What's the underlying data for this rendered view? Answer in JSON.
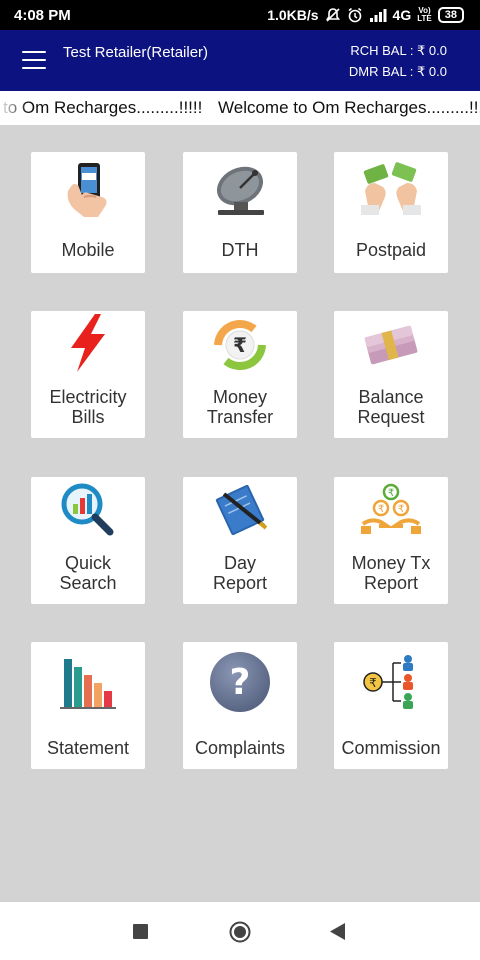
{
  "status_bar": {
    "time": "4:08 PM",
    "speed": "1.0KB/s",
    "network": "4G",
    "volte_top": "Vo)",
    "volte_bottom": "LTE",
    "battery": "38"
  },
  "app_bar": {
    "title": "Test Retailer(Retailer)",
    "rch_balance": "RCH BAL : ₹ 0.0",
    "dmr_balance": "DMR BAL : ₹ 0.0"
  },
  "marquee": {
    "text_1": "to Om Recharges.........!!!!!",
    "text_2": "Welcome to Om Recharges.........!!!!!"
  },
  "tiles": [
    {
      "label_1": "Mobile",
      "label_2": ""
    },
    {
      "label_1": "DTH",
      "label_2": ""
    },
    {
      "label_1": "Postpaid",
      "label_2": ""
    },
    {
      "label_1": "Electricity",
      "label_2": "Bills"
    },
    {
      "label_1": "Money",
      "label_2": "Transfer"
    },
    {
      "label_1": "Balance",
      "label_2": "Request"
    },
    {
      "label_1": "Quick",
      "label_2": "Search"
    },
    {
      "label_1": "Day",
      "label_2": "Report"
    },
    {
      "label_1": "Money Tx",
      "label_2": "Report"
    },
    {
      "label_1": "Statement",
      "label_2": ""
    },
    {
      "label_1": "Complaints",
      "label_2": ""
    },
    {
      "label_1": "Commission",
      "label_2": ""
    }
  ],
  "colors": {
    "app_bar": "#0c127f",
    "background": "#d3d3d3",
    "tile": "#ffffff"
  }
}
